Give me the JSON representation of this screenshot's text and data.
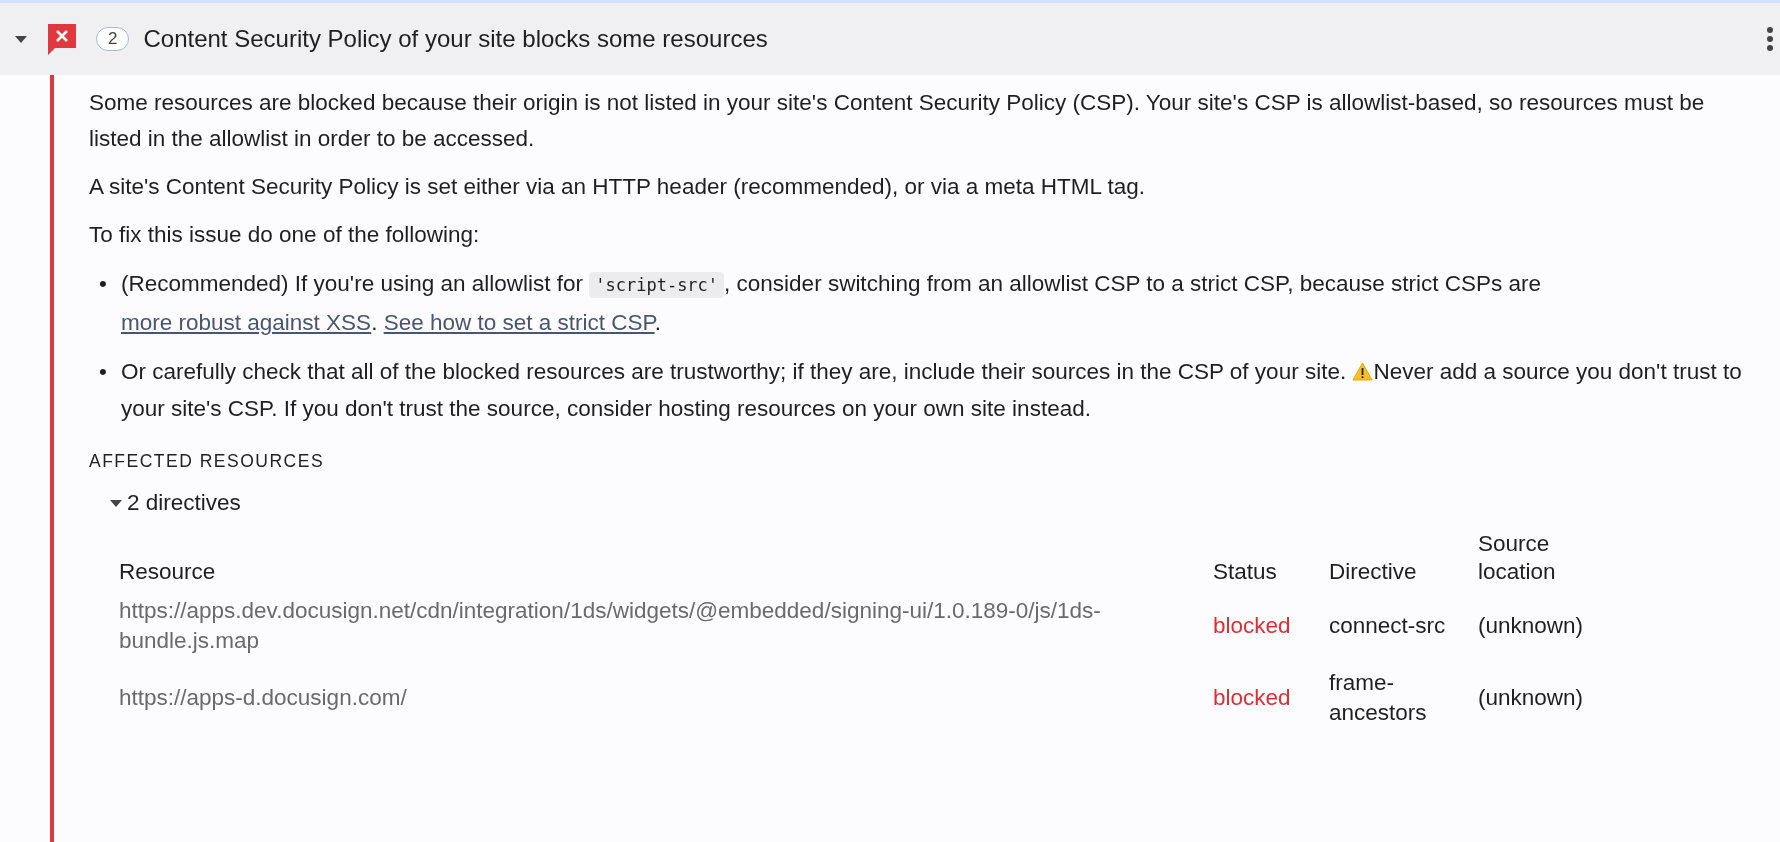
{
  "issue": {
    "expanded": true,
    "count": "2",
    "title": "Content Security Policy of your site blocks some resources"
  },
  "paragraphs": [
    [
      {
        "kind": "text",
        "text": "Some resources are blocked because their origin is not listed in your site's Content Security Policy (CSP). Your site's CSP is allowlist-based, so resources must be listed in the allowlist in order to be accessed."
      }
    ],
    [
      {
        "kind": "text",
        "text": "A site's Content Security Policy is set either via an HTTP header (recommended), or via a meta HTML tag."
      }
    ],
    [
      {
        "kind": "text",
        "text": "To fix this issue do one of the following:"
      }
    ]
  ],
  "bullets": [
    [
      {
        "kind": "marker",
        "text": "•"
      },
      {
        "kind": "text",
        "text": "(Recommended) If you're using an allowlist for "
      },
      {
        "kind": "code",
        "text": "'script-src'"
      },
      {
        "kind": "text",
        "text": ", consider switching from an allowlist CSP to a strict CSP, because strict CSPs are "
      },
      {
        "kind": "link",
        "text": "more robust against XSS"
      },
      {
        "kind": "text",
        "text": ". "
      },
      {
        "kind": "link",
        "text": "See how to set a strict CSP"
      },
      {
        "kind": "text",
        "text": "."
      }
    ],
    [
      {
        "kind": "marker",
        "text": "•"
      },
      {
        "kind": "text",
        "text": "Or carefully check that all of the blocked resources are trustworthy; if they are, include their sources in the CSP of your site. "
      },
      {
        "kind": "warning"
      },
      {
        "kind": "text",
        "text": "Never add a source you don't trust to your site's CSP. If you don't trust the source, consider hosting resources on your own site instead."
      }
    ]
  ],
  "affected": {
    "heading": "AFFECTED RESOURCES",
    "group": {
      "label": "2 directives",
      "expanded": true
    },
    "columns": [
      "Resource",
      "Status",
      "Directive",
      "Source location"
    ],
    "rows": [
      [
        "https://apps.dev.docusign.net/cdn/integration/1ds/widgets/@embedded/signing-ui/1.0.189-0/js/1ds-bundle.js.map",
        "blocked",
        "connect-src",
        "(unknown)"
      ],
      [
        "https://apps-d.docusign.com/",
        "blocked",
        "frame-ancestors",
        "(unknown)"
      ]
    ]
  }
}
